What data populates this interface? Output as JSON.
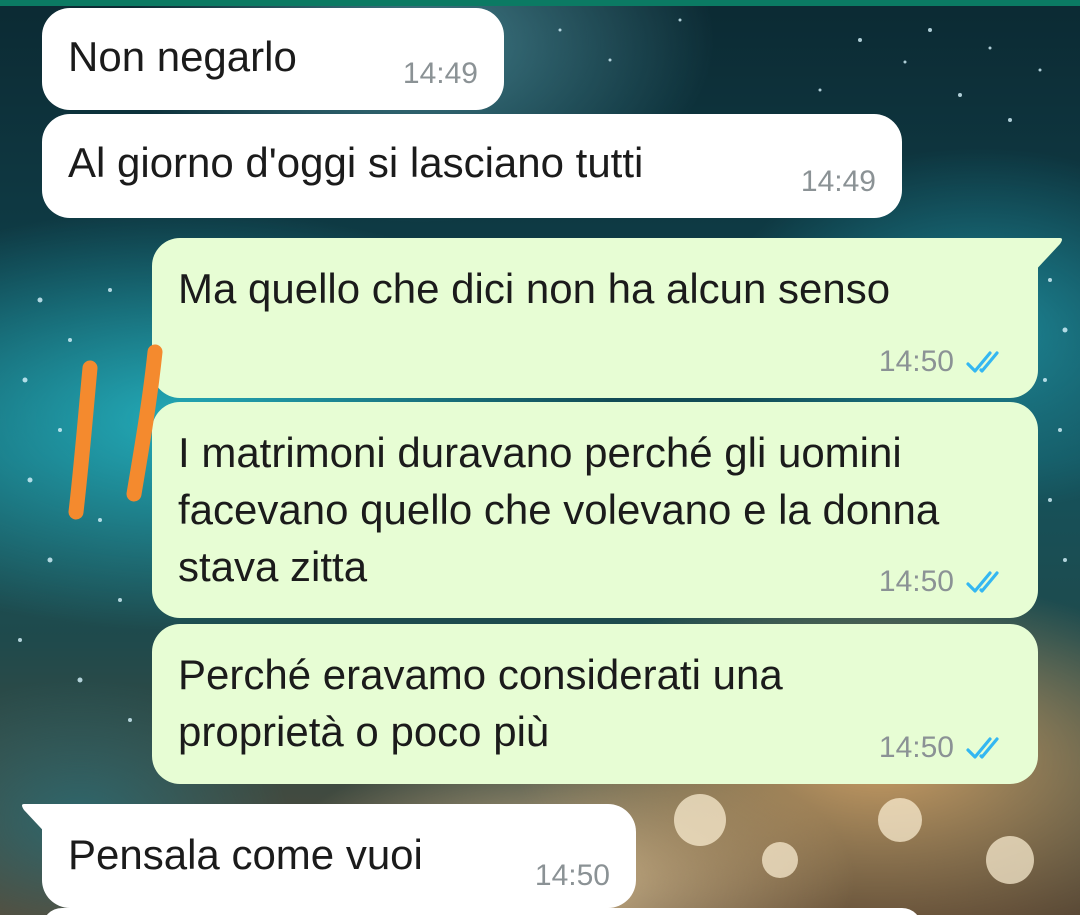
{
  "theme": {
    "incoming_bubble": "#ffffff",
    "outgoing_bubble": "#e7fdd4",
    "timestamp_color": "#8b9295",
    "read_ticks_color": "#34b7f1",
    "highlight_marks_color": "#f48a2e",
    "header_strip": "#0b7a63"
  },
  "messages": [
    {
      "direction": "incoming",
      "text": "Non negarlo",
      "time": "14:49"
    },
    {
      "direction": "incoming",
      "text": "Al giorno d'oggi si lasciano tutti",
      "time": "14:49"
    },
    {
      "direction": "outgoing",
      "text": "Ma quello che dici non ha alcun senso",
      "time": "14:50",
      "status_icon": "double-check-read-icon"
    },
    {
      "direction": "outgoing",
      "text": "I matrimoni duravano perché gli uomini facevano quello che volevano e la donna stava zitta",
      "time": "14:50",
      "status_icon": "double-check-read-icon"
    },
    {
      "direction": "outgoing",
      "text": "Perché eravamo considerati una proprietà o poco più",
      "time": "14:50",
      "status_icon": "double-check-read-icon"
    },
    {
      "direction": "incoming",
      "text": "Pensala come vuoi",
      "time": "14:50"
    }
  ]
}
